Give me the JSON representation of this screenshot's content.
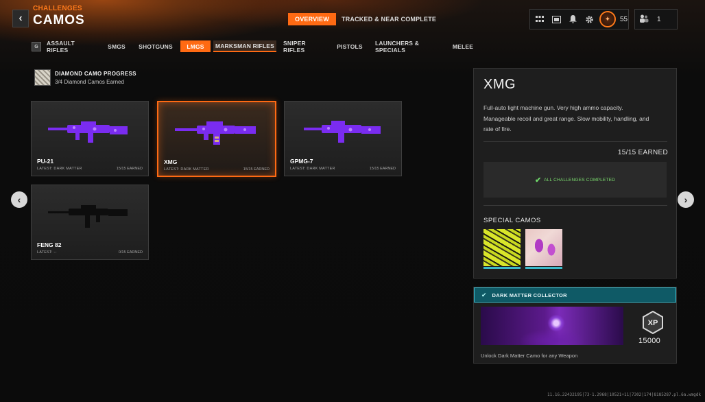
{
  "header": {
    "breadcrumb": "CHALLENGES",
    "title": "CAMOS",
    "tabs": [
      {
        "label": "OVERVIEW",
        "active": true
      },
      {
        "label": "TRACKED & NEAR COMPLETE",
        "active": false
      }
    ],
    "level": "55",
    "party_count": "1"
  },
  "categories": {
    "key_hint": "G",
    "items": [
      {
        "label": "ASSAULT RIFLES"
      },
      {
        "label": "SMGS"
      },
      {
        "label": "SHOTGUNS"
      },
      {
        "label": "LMGS",
        "active": true
      },
      {
        "label": "MARKSMAN RIFLES",
        "hover": true
      },
      {
        "label": "SNIPER RIFLES"
      },
      {
        "label": "PISTOLS"
      },
      {
        "label": "LAUNCHERS & SPECIALS"
      },
      {
        "label": "MELEE"
      }
    ]
  },
  "progress": {
    "title": "DIAMOND CAMO PROGRESS",
    "subtitle": "3/4 Diamond Camos Earned"
  },
  "weapons": [
    {
      "name": "PU-21",
      "latest": "LATEST: DARK MATTER",
      "earned": "15/15 EARNED",
      "camo": "purple",
      "selected": false
    },
    {
      "name": "XMG",
      "latest": "LATEST: DARK MATTER",
      "earned": "15/15 EARNED",
      "camo": "purple",
      "selected": true
    },
    {
      "name": "GPMG-7",
      "latest": "LATEST: DARK MATTER",
      "earned": "15/15 EARNED",
      "camo": "purple",
      "selected": false
    },
    {
      "name": "FENG 82",
      "latest": "LATEST: --",
      "earned": "0/15 EARNED",
      "camo": "black",
      "selected": false
    }
  ],
  "detail": {
    "title": "XMG",
    "description": "Full-auto light machine gun.  Very high ammo capacity. Manageable recoil and great range. Slow mobility, handling, and rate of fire.",
    "earned": "15/15 EARNED",
    "complete_text": "ALL CHALLENGES COMPLETED",
    "special_label": "SPECIAL CAMOS"
  },
  "achievement": {
    "title": "DARK MATTER COLLECTOR",
    "xp_label": "XP",
    "xp": "15000",
    "description": "Unlock Dark Matter Camo for any Weapon"
  },
  "version": "11.16.22432195|73-1.2968|10521+11|7302|174|8185287.pl.6a.wmgdk",
  "colors": {
    "accent": "#ff6a13",
    "teal": "#3ab8c9",
    "success": "#7bdc6e",
    "camo_purple": "#7a2cf0"
  }
}
